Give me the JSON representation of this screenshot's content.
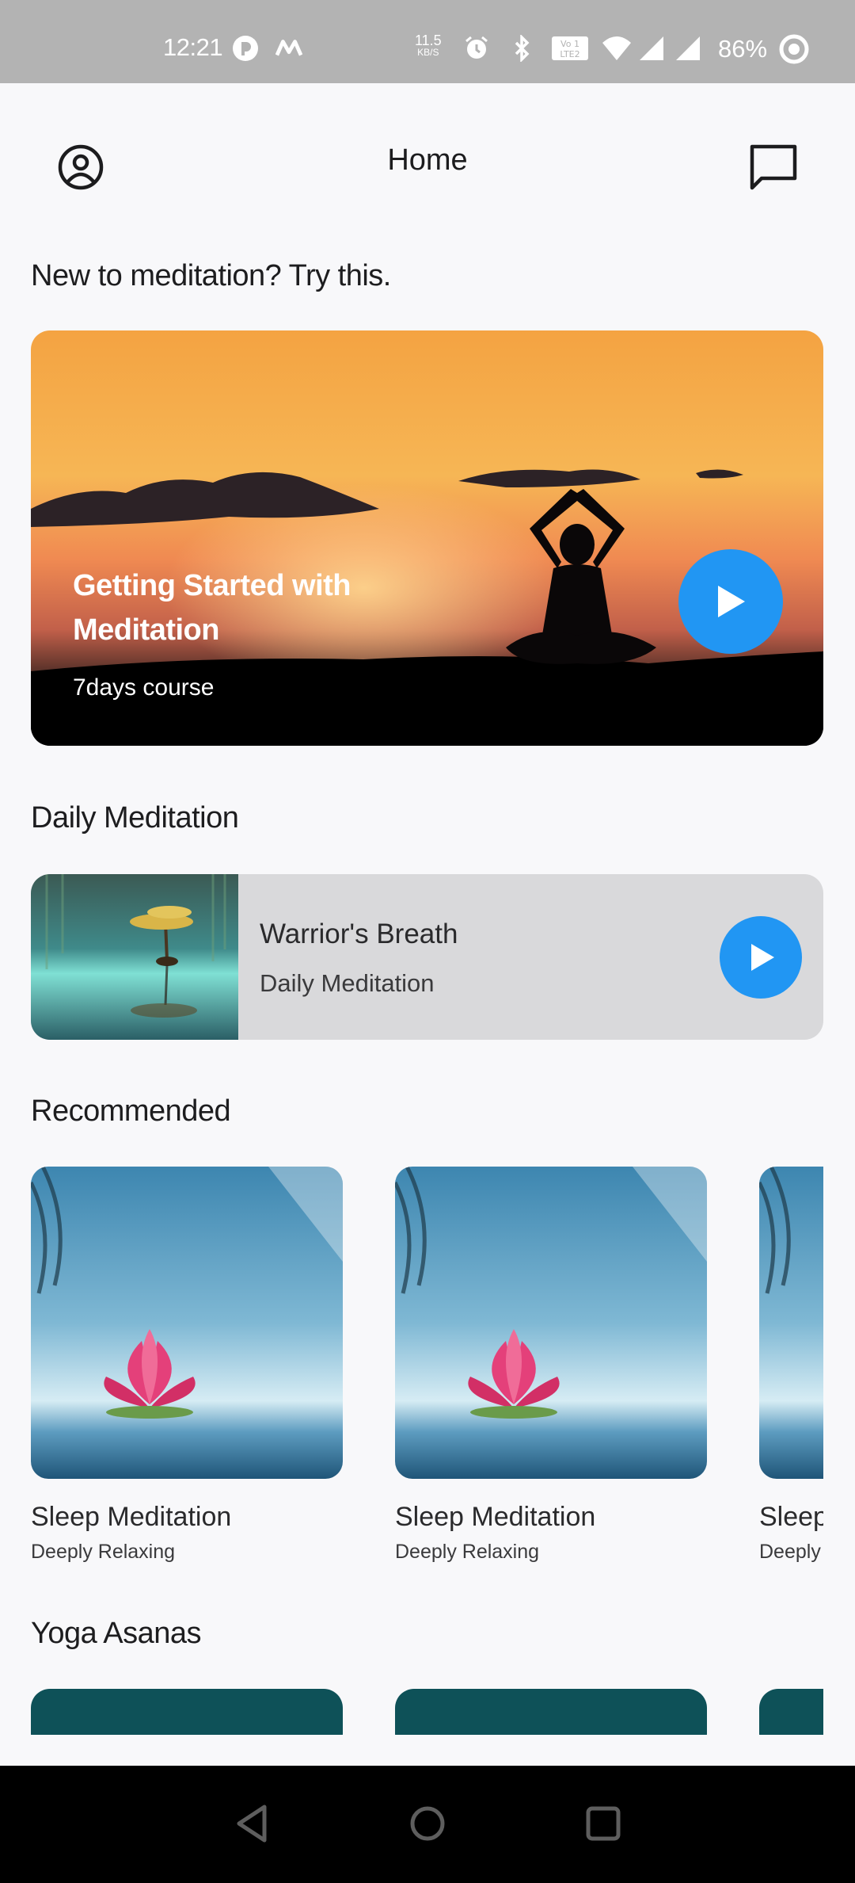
{
  "status_bar": {
    "time": "12:21",
    "net_speed_value": "11.5",
    "net_speed_unit": "KB/S",
    "battery": "86%",
    "icons": [
      "app-notification-icon",
      "m-app-icon",
      "alarm-icon",
      "bluetooth-icon",
      "volte-icon",
      "wifi-icon",
      "signal-icon",
      "signal-icon",
      "battery-icon"
    ]
  },
  "app_bar": {
    "title": "Home",
    "left_icon": "profile-icon",
    "right_icon": "chat-icon"
  },
  "intro_section": {
    "heading": "New to meditation? Try this.",
    "card": {
      "title": "Getting Started with Meditation",
      "subtitle": "7days course",
      "action_icon": "play-icon"
    }
  },
  "daily_section": {
    "heading": "Daily Meditation",
    "card": {
      "title": "Warrior's Breath",
      "subtitle": "Daily Meditation",
      "action_icon": "play-icon"
    }
  },
  "recommended_section": {
    "heading": "Recommended",
    "items": [
      {
        "title": "Sleep Meditation",
        "subtitle": "Deeply Relaxing"
      },
      {
        "title": "Sleep Meditation",
        "subtitle": "Deeply Relaxing"
      },
      {
        "title": "Sleep Meditation",
        "subtitle": "Deeply Relaxing"
      }
    ]
  },
  "yoga_section": {
    "heading": "Yoga Asanas"
  },
  "colors": {
    "accent": "#2196f3",
    "background": "#f8f8fa",
    "card_gray": "#d9d9db",
    "yoga_teal": "#0e5158",
    "status_bar": "#b3b3b3"
  },
  "nav_bar": {
    "buttons": [
      "back-icon",
      "home-icon",
      "recents-icon"
    ]
  }
}
